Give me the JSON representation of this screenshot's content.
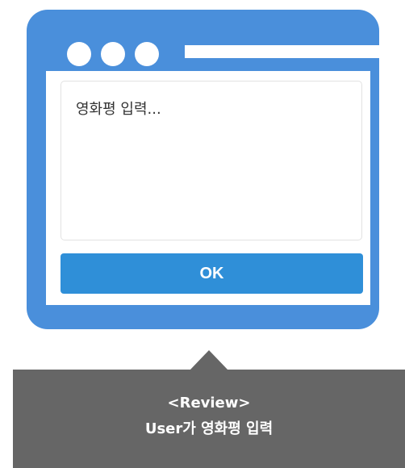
{
  "window": {
    "review_placeholder": "영화평 입력...",
    "ok_label": "OK"
  },
  "caption": {
    "line1": "<Review>",
    "line2": "User가 영화평 입력"
  },
  "colors": {
    "frame": "#4a8fdb",
    "button": "#2f8fd8",
    "caption_bg": "#666666"
  }
}
